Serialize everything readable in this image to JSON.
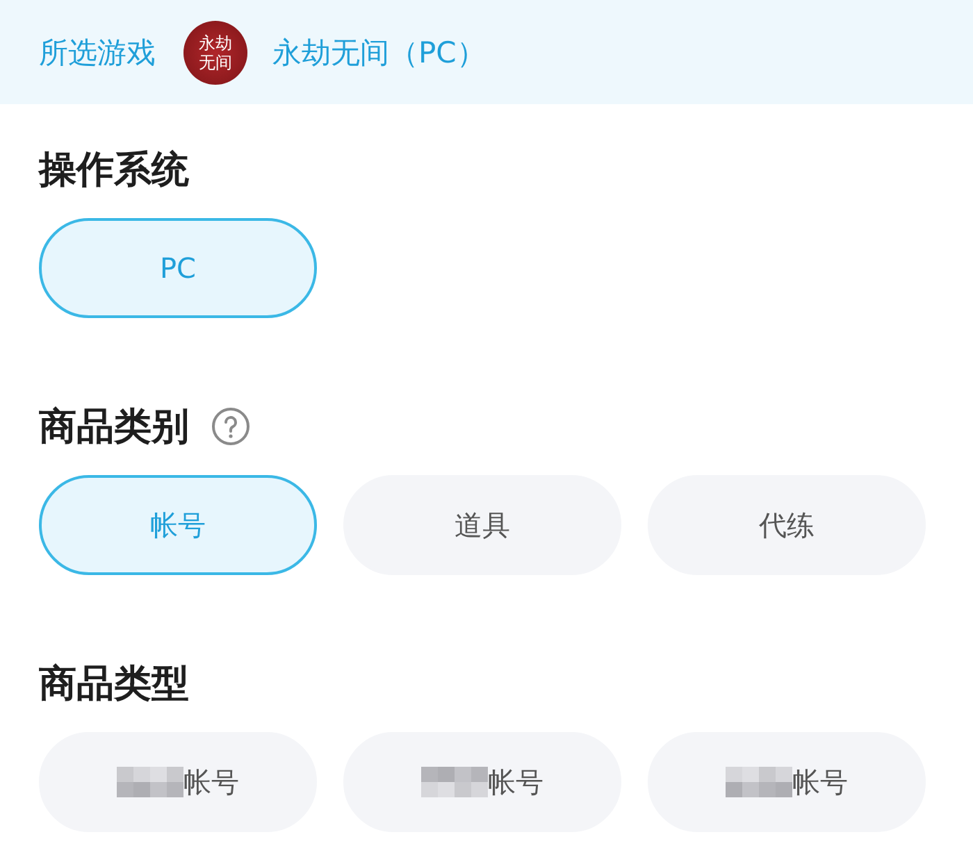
{
  "header": {
    "label": "所选游戏",
    "logo_text": "永劫无间",
    "game": "永劫无间（PC）"
  },
  "sections": [
    {
      "title": "操作系统",
      "help": false,
      "options": [
        {
          "label": "PC",
          "selected": true,
          "redacted": false
        }
      ]
    },
    {
      "title": "商品类别",
      "help": true,
      "options": [
        {
          "label": "帐号",
          "selected": true,
          "redacted": false
        },
        {
          "label": "道具",
          "selected": false,
          "redacted": false
        },
        {
          "label": "代练",
          "selected": false,
          "redacted": false
        }
      ]
    },
    {
      "title": "商品类型",
      "help": false,
      "options": [
        {
          "label": "帐号",
          "selected": false,
          "redacted": true
        },
        {
          "label": "帐号",
          "selected": false,
          "redacted": true
        },
        {
          "label": "帐号",
          "selected": false,
          "redacted": true
        }
      ]
    }
  ]
}
